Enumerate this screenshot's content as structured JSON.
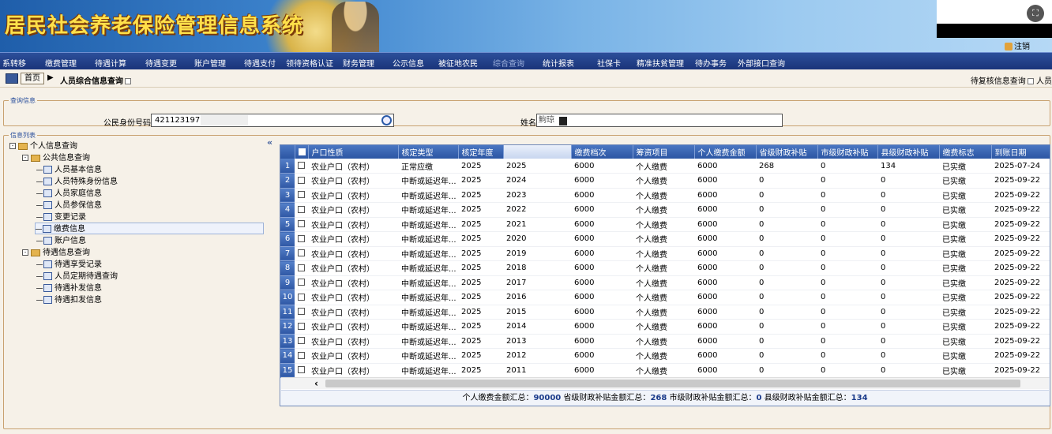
{
  "app": {
    "title": "居民社会养老保险管理信息系统",
    "logout": "注销"
  },
  "nav": [
    "系转移",
    "缴费管理",
    "待遇计算",
    "待遇变更",
    "账户管理",
    "待遇支付",
    "领待资格认证",
    "财务管理",
    "公示信息",
    "被征地农民",
    "综合查询",
    "统计报表",
    "社保卡",
    "精准扶贫管理",
    "待办事务",
    "外部接口查询"
  ],
  "breadcrumb": {
    "home": "首页",
    "current": "人员综合信息查询",
    "right": "待复核信息查询",
    "right2": "人员"
  },
  "query": {
    "legend": "查询信息",
    "id_label": "公民身份号码",
    "id_value": "421123197",
    "name_label": "姓名",
    "name_value": "鮈琼"
  },
  "list": {
    "legend": "信息列表"
  },
  "tree": {
    "root": "个人信息查询",
    "public": "公共信息查询",
    "public_items": [
      "人员基本信息",
      "人员特殊身份信息",
      "人员家庭信息",
      "人员参保信息",
      "变更记录",
      "缴费信息",
      "账户信息"
    ],
    "benefit": "待遇信息查询",
    "benefit_items": [
      "待遇享受记录",
      "人员定期待遇查询",
      "待遇补发信息",
      "待遇扣发信息"
    ]
  },
  "table": {
    "headers": [
      "户口性质",
      "核定类型",
      "核定年度",
      "",
      "缴费档次",
      "筹资项目",
      "个人缴费金额",
      "省级财政补贴",
      "市级财政补贴",
      "县级财政补贴",
      "缴费标志",
      "到账日期"
    ],
    "rows": [
      [
        "1",
        "农业户口（农村）",
        "正常应缴",
        "2025",
        "2025",
        "6000",
        "个人缴费",
        "6000",
        "268",
        "0",
        "134",
        "已实缴",
        "2025-07-24"
      ],
      [
        "2",
        "农业户口（农村）",
        "中断或延迟年...",
        "2025",
        "2024",
        "6000",
        "个人缴费",
        "6000",
        "0",
        "0",
        "0",
        "已实缴",
        "2025-09-22"
      ],
      [
        "3",
        "农业户口（农村）",
        "中断或延迟年...",
        "2025",
        "2023",
        "6000",
        "个人缴费",
        "6000",
        "0",
        "0",
        "0",
        "已实缴",
        "2025-09-22"
      ],
      [
        "4",
        "农业户口（农村）",
        "中断或延迟年...",
        "2025",
        "2022",
        "6000",
        "个人缴费",
        "6000",
        "0",
        "0",
        "0",
        "已实缴",
        "2025-09-22"
      ],
      [
        "5",
        "农业户口（农村）",
        "中断或延迟年...",
        "2025",
        "2021",
        "6000",
        "个人缴费",
        "6000",
        "0",
        "0",
        "0",
        "已实缴",
        "2025-09-22"
      ],
      [
        "6",
        "农业户口（农村）",
        "中断或延迟年...",
        "2025",
        "2020",
        "6000",
        "个人缴费",
        "6000",
        "0",
        "0",
        "0",
        "已实缴",
        "2025-09-22"
      ],
      [
        "7",
        "农业户口（农村）",
        "中断或延迟年...",
        "2025",
        "2019",
        "6000",
        "个人缴费",
        "6000",
        "0",
        "0",
        "0",
        "已实缴",
        "2025-09-22"
      ],
      [
        "8",
        "农业户口（农村）",
        "中断或延迟年...",
        "2025",
        "2018",
        "6000",
        "个人缴费",
        "6000",
        "0",
        "0",
        "0",
        "已实缴",
        "2025-09-22"
      ],
      [
        "9",
        "农业户口（农村）",
        "中断或延迟年...",
        "2025",
        "2017",
        "6000",
        "个人缴费",
        "6000",
        "0",
        "0",
        "0",
        "已实缴",
        "2025-09-22"
      ],
      [
        "10",
        "农业户口（农村）",
        "中断或延迟年...",
        "2025",
        "2016",
        "6000",
        "个人缴费",
        "6000",
        "0",
        "0",
        "0",
        "已实缴",
        "2025-09-22"
      ],
      [
        "11",
        "农业户口（农村）",
        "中断或延迟年...",
        "2025",
        "2015",
        "6000",
        "个人缴费",
        "6000",
        "0",
        "0",
        "0",
        "已实缴",
        "2025-09-22"
      ],
      [
        "12",
        "农业户口（农村）",
        "中断或延迟年...",
        "2025",
        "2014",
        "6000",
        "个人缴费",
        "6000",
        "0",
        "0",
        "0",
        "已实缴",
        "2025-09-22"
      ],
      [
        "13",
        "农业户口（农村）",
        "中断或延迟年...",
        "2025",
        "2013",
        "6000",
        "个人缴费",
        "6000",
        "0",
        "0",
        "0",
        "已实缴",
        "2025-09-22"
      ],
      [
        "14",
        "农业户口（农村）",
        "中断或延迟年...",
        "2025",
        "2012",
        "6000",
        "个人缴费",
        "6000",
        "0",
        "0",
        "0",
        "已实缴",
        "2025-09-22"
      ],
      [
        "15",
        "农业户口（农村）",
        "中断或延迟年...",
        "2025",
        "2011",
        "6000",
        "个人缴费",
        "6000",
        "0",
        "0",
        "0",
        "已实缴",
        "2025-09-22"
      ]
    ]
  },
  "summary": {
    "personal_label": "个人缴费金额汇总：",
    "personal": "90000",
    "province_label": "省级财政补贴金额汇总：",
    "province": "268",
    "city_label": "市级财政补贴金额汇总：",
    "city": "0",
    "county_label": "县级财政补贴金额汇总：",
    "county": "134"
  }
}
